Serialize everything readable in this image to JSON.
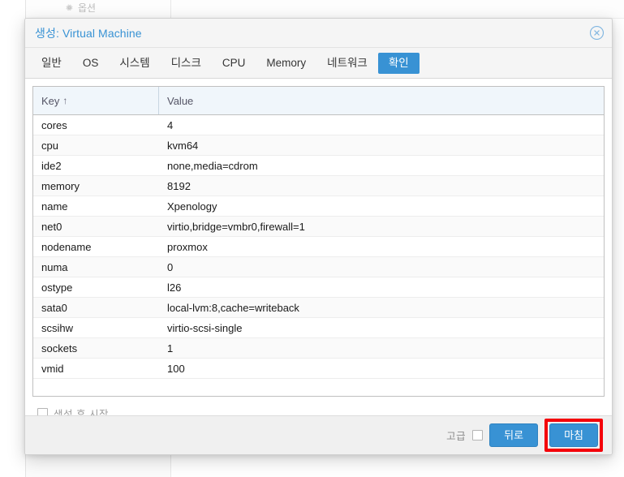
{
  "background": {
    "option_label": "옵션",
    "option_icon": "gear-icon"
  },
  "dialog": {
    "title": "생성: Virtual Machine",
    "close_icon": "close-circle-icon",
    "tabs": [
      {
        "label": "일반",
        "active": false
      },
      {
        "label": "OS",
        "active": false
      },
      {
        "label": "시스템",
        "active": false
      },
      {
        "label": "디스크",
        "active": false
      },
      {
        "label": "CPU",
        "active": false
      },
      {
        "label": "Memory",
        "active": false
      },
      {
        "label": "네트워크",
        "active": false
      },
      {
        "label": "확인",
        "active": true
      }
    ],
    "grid": {
      "columns": [
        {
          "label": "Key",
          "sort_indicator": "↑"
        },
        {
          "label": "Value",
          "sort_indicator": ""
        }
      ],
      "rows": [
        {
          "key": "cores",
          "value": "4"
        },
        {
          "key": "cpu",
          "value": "kvm64"
        },
        {
          "key": "ide2",
          "value": "none,media=cdrom"
        },
        {
          "key": "memory",
          "value": "8192"
        },
        {
          "key": "name",
          "value": "Xpenology"
        },
        {
          "key": "net0",
          "value": "virtio,bridge=vmbr0,firewall=1"
        },
        {
          "key": "nodename",
          "value": "proxmox"
        },
        {
          "key": "numa",
          "value": "0"
        },
        {
          "key": "ostype",
          "value": "l26"
        },
        {
          "key": "sata0",
          "value": "local-lvm:8,cache=writeback"
        },
        {
          "key": "scsihw",
          "value": "virtio-scsi-single"
        },
        {
          "key": "sockets",
          "value": "1"
        },
        {
          "key": "vmid",
          "value": "100"
        }
      ]
    },
    "start_after_create": {
      "label": "생성 후 시작",
      "checked": false
    },
    "footer": {
      "advanced_label": "고급",
      "advanced_checked": false,
      "back_label": "뒤로",
      "finish_label": "마침"
    }
  },
  "colors": {
    "accent": "#3892d4",
    "highlight": "#f40009",
    "header_bg": "#f5f5f5",
    "grid_header_bg": "#f0f6fb",
    "row_alt_bg": "#fafafa"
  }
}
